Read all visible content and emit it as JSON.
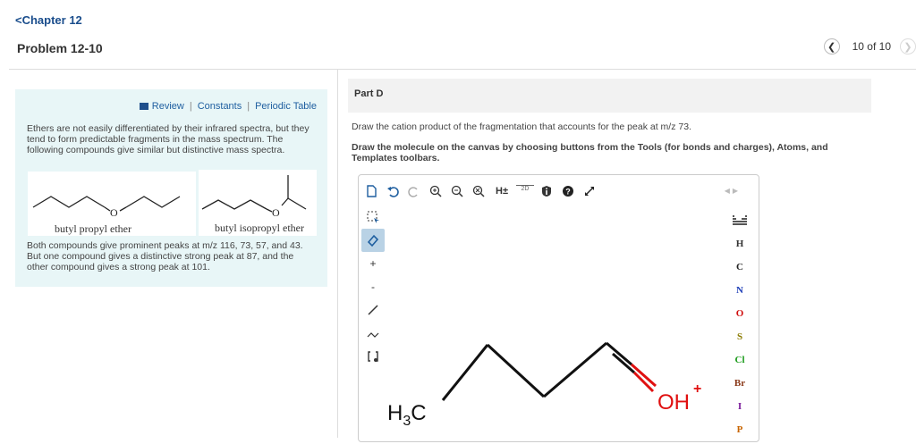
{
  "header": {
    "back_label": "Chapter 12",
    "problem_title": "Problem 12-10",
    "page_count": "10 of 10"
  },
  "left": {
    "links": [
      "Review",
      "Constants",
      "Periodic Table"
    ],
    "intro": "Ethers are not easily differentiated by their infrared spectra, but they tend to form predictable fragments in the mass spectrum. The following compounds give similar but distinctive mass spectra.",
    "mol1_label": "butyl propyl ether",
    "mol2_label": "butyl isopropyl ether",
    "oxygen": "O",
    "outro": "Both compounds give prominent peaks at m/z 116, 73, 57, and 43. But one compound gives a distinctive strong peak at 87, and the other compound gives a strong peak at 101."
  },
  "right": {
    "part_title": "Part D",
    "question": "Draw the cation product of the fragmentation that accounts for the peak at m/z 73.",
    "instructions": "Draw the molecule on the canvas by choosing buttons from the Tools (for bonds and charges), Atoms, and Templates toolbars."
  },
  "editor": {
    "toolbar": [
      "new-icon",
      "undo-icon",
      "redo-icon",
      "zoom-in-icon",
      "zoom-out-icon",
      "zoom-reset-icon",
      "H±",
      "2D",
      "info-icon",
      "help-icon",
      "expand-icon"
    ],
    "left_tools": [
      "select-icon",
      "erase-icon",
      "+",
      "-",
      "bond-icon",
      "chain-icon",
      "bracket-icon"
    ],
    "atoms": [
      {
        "label": "H",
        "color": "#333333"
      },
      {
        "label": "C",
        "color": "#222222"
      },
      {
        "label": "N",
        "color": "#1f3fb8"
      },
      {
        "label": "O",
        "color": "#d01010"
      },
      {
        "label": "S",
        "color": "#8a7a00"
      },
      {
        "label": "Cl",
        "color": "#1a9a1a"
      },
      {
        "label": "Br",
        "color": "#8a3a1a"
      },
      {
        "label": "I",
        "color": "#7a1a9a"
      },
      {
        "label": "P",
        "color": "#c86400"
      }
    ],
    "canvas": {
      "left_group": "H3C",
      "right_group": "OH",
      "charge": "+"
    }
  }
}
